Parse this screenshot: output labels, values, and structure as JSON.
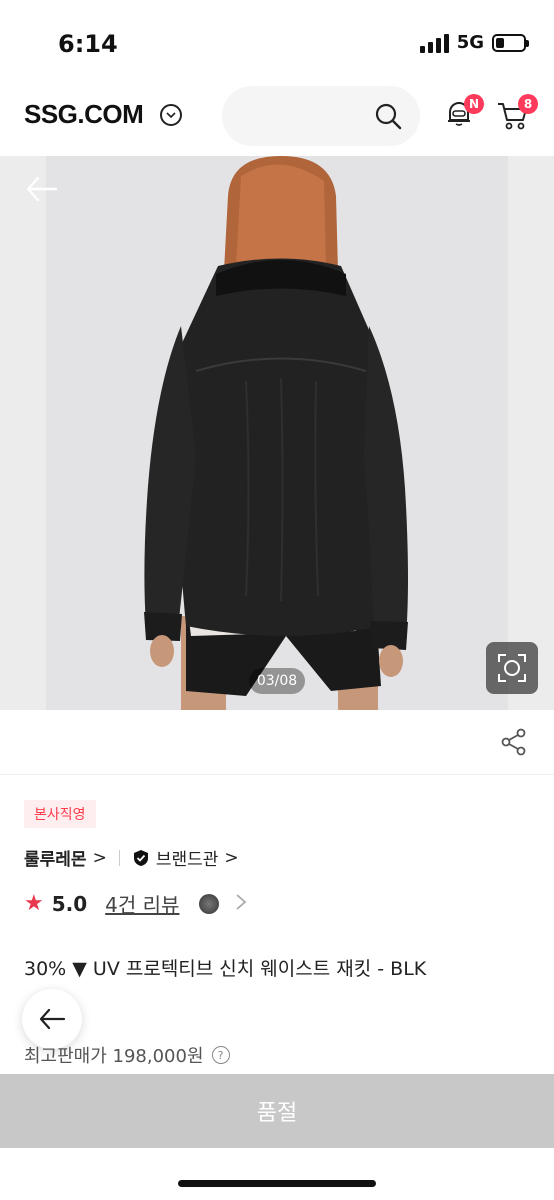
{
  "status": {
    "time": "6:14",
    "network": "5G",
    "battery_level": 0.3
  },
  "header": {
    "logo": "SSG.COM",
    "notification_badge": "N",
    "cart_count": "8",
    "accent_color": "#ff3b5b"
  },
  "gallery": {
    "page_indicator": "03/08"
  },
  "product": {
    "tag": "본사직영",
    "brand": "룰루레몬",
    "brand_chevron": ">",
    "brand_hall": "브랜드관",
    "brand_hall_chevron": ">",
    "rating_star": "★",
    "rating": "5.0",
    "reviews": "4건 리뷰",
    "title": "30% ▼  UV 프로텍티브 신치 웨이스트 재킷 - BLK",
    "price_label": "최고판매가 198,000원",
    "help": "?"
  },
  "footer": {
    "soldout_label": "품절"
  }
}
